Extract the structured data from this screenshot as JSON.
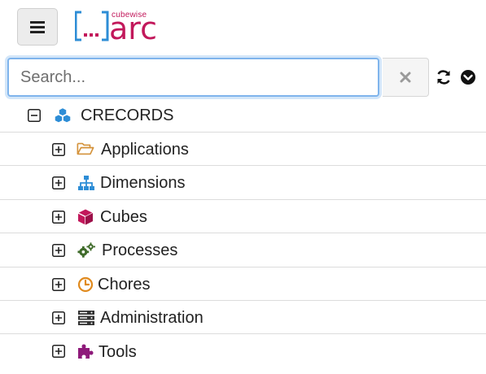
{
  "header": {
    "menu_icon": "hamburger-icon",
    "logo": {
      "small_text": "cubewise",
      "main_text": "arc",
      "brackets": "[...]",
      "colors": {
        "bracket": "#2d8dd6",
        "dots": "#c2185b",
        "text": "#c2185b"
      }
    }
  },
  "search": {
    "placeholder": "Search...",
    "value": "",
    "clear_icon": "times-icon",
    "refresh_icon": "refresh-icon",
    "menu_icon": "chevron-circle-down-icon"
  },
  "tree": {
    "root": {
      "label": "CRECORDS",
      "icon": "cubes-icon",
      "expanded": true,
      "icon_color": "#2d8dd6"
    },
    "items": [
      {
        "label": "Applications",
        "icon": "folder-open-icon",
        "icon_color": "#d4923a"
      },
      {
        "label": "Dimensions",
        "icon": "sitemap-icon",
        "icon_color": "#2d8dd6"
      },
      {
        "label": "Cubes",
        "icon": "cube-icon",
        "icon_color": "#c2185b"
      },
      {
        "label": "Processes",
        "icon": "cogs-icon",
        "icon_color": "#3f6b2a"
      },
      {
        "label": "Chores",
        "icon": "clock-icon",
        "icon_color": "#e08a1e"
      },
      {
        "label": "Administration",
        "icon": "server-icon",
        "icon_color": "#333333"
      },
      {
        "label": "Tools",
        "icon": "puzzle-icon",
        "icon_color": "#8e1a7a"
      }
    ]
  }
}
